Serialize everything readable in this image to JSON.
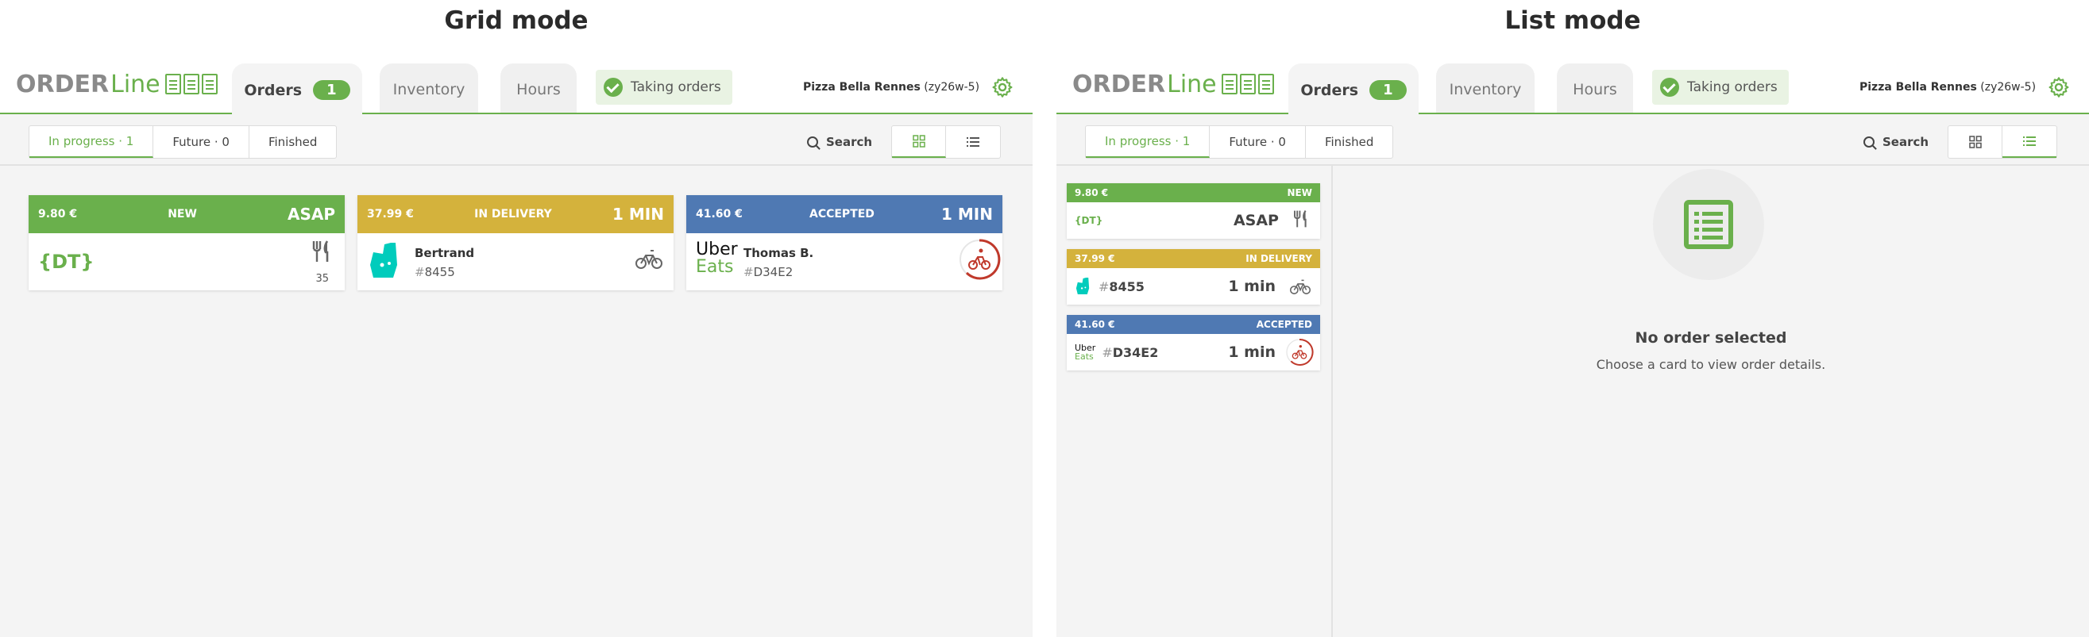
{
  "titles": {
    "grid": "Grid mode",
    "list": "List mode"
  },
  "header": {
    "logo_order": "ORDER",
    "logo_line": "Line",
    "tabs": {
      "orders": "Orders",
      "orders_badge": "1",
      "inventory": "Inventory",
      "hours": "Hours"
    },
    "status": "Taking orders",
    "restaurant_name": "Pizza Bella Rennes",
    "restaurant_id": "(zy26w-5)"
  },
  "toolbar": {
    "filters": [
      {
        "label": "In progress",
        "count": "1"
      },
      {
        "label": "Future",
        "count": "0"
      },
      {
        "label": "Finished"
      }
    ],
    "search_label": "Search"
  },
  "grid_orders": [
    {
      "price": "9.80 €",
      "status": "NEW",
      "eta": "ASAP",
      "code": "{DT}",
      "covers": "35",
      "icon": "cutlery-icon",
      "color": "#6ab04c"
    },
    {
      "price": "37.99 €",
      "status": "IN DELIVERY",
      "eta": "1 MIN",
      "customer": "Bertrand",
      "hash": "#",
      "ref": "8455",
      "icon": "bicycle-icon",
      "platform": "deliveroo-logo",
      "color": "#d4b23c"
    },
    {
      "price": "41.60 €",
      "status": "ACCEPTED",
      "eta": "1 MIN",
      "customer": "Thomas B.",
      "hash": "#",
      "ref": "D34E2",
      "icon": "courier-timer-icon",
      "platform": "uber-eats-logo",
      "platform_text_1": "Uber",
      "platform_text_2": "Eats",
      "color": "#4f79b3"
    }
  ],
  "list_orders": [
    {
      "price": "9.80 €",
      "status": "NEW",
      "eta": "ASAP",
      "code": "{DT}"
    },
    {
      "price": "37.99 €",
      "status": "IN DELIVERY",
      "eta": "1 min",
      "hash": "#",
      "ref": "8455"
    },
    {
      "price": "41.60 €",
      "status": "ACCEPTED",
      "eta": "1 min",
      "hash": "#",
      "ref": "D34E2",
      "platform_text_1": "Uber",
      "platform_text_2": "Eats"
    }
  ],
  "empty_state": {
    "title": "No order selected",
    "subtitle": "Choose a card to view order details."
  },
  "colors": {
    "accent": "#6ab04c",
    "delivery": "#d4b23c",
    "accepted": "#4f79b3",
    "alert": "#c0392b",
    "deliveroo": "#00ccbc"
  }
}
